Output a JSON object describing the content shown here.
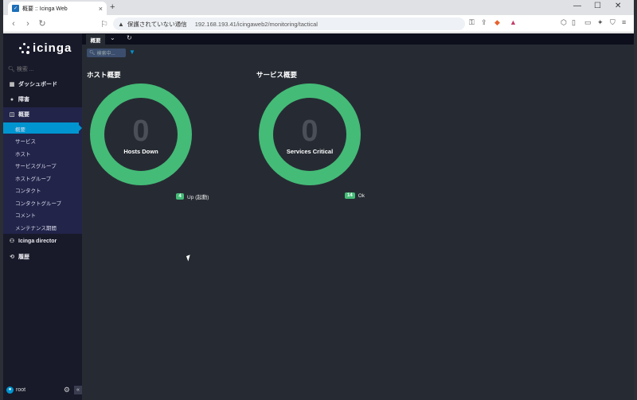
{
  "browser": {
    "tab_title": "概要 :: Icinga Web",
    "tab_favicon": "icinga-favicon",
    "new_tab": "+",
    "security_warning": "保護されていない通信",
    "url": "192.168.193.41/icingaweb2/monitoring/tactical",
    "colors": {
      "tabstrip": "#dfe1e5",
      "urlbar": "#eef1f5"
    }
  },
  "sidebar": {
    "logo": "icinga",
    "search_placeholder": "検索 ...",
    "items": [
      {
        "label": "ダッシュボード",
        "icon": "dashboard-icon"
      },
      {
        "label": "障害",
        "icon": "problems-icon"
      },
      {
        "label": "概要",
        "icon": "binoculars-icon"
      },
      {
        "label": "Icinga director",
        "icon": "director-icon"
      },
      {
        "label": "履歴",
        "icon": "history-icon"
      }
    ],
    "subitems": [
      {
        "label": "概要",
        "active": true
      },
      {
        "label": "サービス"
      },
      {
        "label": "ホスト"
      },
      {
        "label": "サービスグループ"
      },
      {
        "label": "ホストグループ"
      },
      {
        "label": "コンタクト"
      },
      {
        "label": "コンタクトグループ"
      },
      {
        "label": "コメント"
      },
      {
        "label": "メンテナンス期間"
      }
    ],
    "user": "root",
    "colors": {
      "background": "#181a2a",
      "submenu": "#22244a",
      "active": "#0095d0"
    }
  },
  "main": {
    "active_tab": "概要",
    "search_placeholder": "検索中...",
    "hosts": {
      "title": "ホスト概要",
      "count": "0",
      "caption": "Hosts Down",
      "legend_count": "4",
      "legend_label": "Up (起動)"
    },
    "services": {
      "title": "サービス概要",
      "count": "0",
      "caption": "Services Critical",
      "legend_count": "14",
      "legend_label": "Ok"
    },
    "colors": {
      "ok": "#44bb77",
      "background": "#262b33",
      "count": "#4a4f58"
    }
  }
}
